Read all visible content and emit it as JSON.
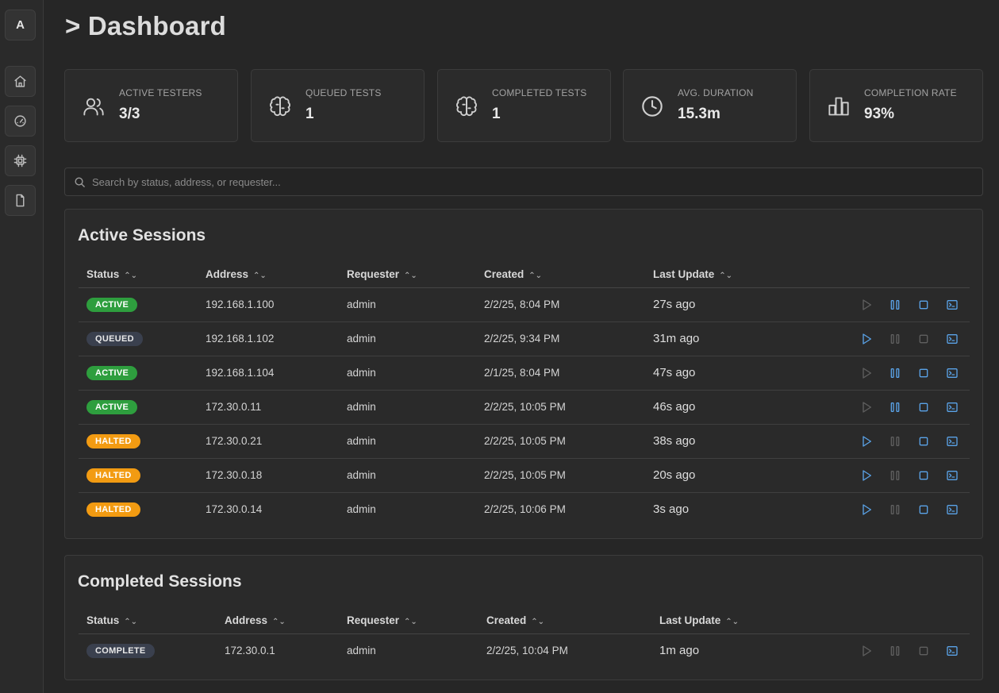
{
  "sidebar": {
    "avatar_letter": "A",
    "items": [
      {
        "name": "home-icon"
      },
      {
        "name": "gauge-icon"
      },
      {
        "name": "chip-icon"
      },
      {
        "name": "file-icon"
      }
    ]
  },
  "page": {
    "title": "> Dashboard"
  },
  "stats": [
    {
      "label": "ACTIVE TESTERS",
      "value": "3/3",
      "icon": "users-icon"
    },
    {
      "label": "QUEUED TESTS",
      "value": "1",
      "icon": "brain-icon"
    },
    {
      "label": "COMPLETED TESTS",
      "value": "1",
      "icon": "brain-icon"
    },
    {
      "label": "AVG. DURATION",
      "value": "15.3m",
      "icon": "clock-icon"
    },
    {
      "label": "COMPLETION RATE",
      "value": "93%",
      "icon": "bar-chart-icon"
    }
  ],
  "search": {
    "placeholder": "Search by status, address, or requester..."
  },
  "active_sessions": {
    "title": "Active Sessions",
    "columns": [
      "Status",
      "Address",
      "Requester",
      "Created",
      "Last Update"
    ],
    "rows": [
      {
        "status": "ACTIVE",
        "address": "192.168.1.100",
        "requester": "admin",
        "created": "2/2/25, 8:04 PM",
        "last_update": "27s ago"
      },
      {
        "status": "QUEUED",
        "address": "192.168.1.102",
        "requester": "admin",
        "created": "2/2/25, 9:34 PM",
        "last_update": "31m ago"
      },
      {
        "status": "ACTIVE",
        "address": "192.168.1.104",
        "requester": "admin",
        "created": "2/1/25, 8:04 PM",
        "last_update": "47s ago"
      },
      {
        "status": "ACTIVE",
        "address": "172.30.0.11",
        "requester": "admin",
        "created": "2/2/25, 10:05 PM",
        "last_update": "46s ago"
      },
      {
        "status": "HALTED",
        "address": "172.30.0.21",
        "requester": "admin",
        "created": "2/2/25, 10:05 PM",
        "last_update": "38s ago"
      },
      {
        "status": "HALTED",
        "address": "172.30.0.18",
        "requester": "admin",
        "created": "2/2/25, 10:05 PM",
        "last_update": "20s ago"
      },
      {
        "status": "HALTED",
        "address": "172.30.0.14",
        "requester": "admin",
        "created": "2/2/25, 10:06 PM",
        "last_update": "3s ago"
      }
    ]
  },
  "completed_sessions": {
    "title": "Completed Sessions",
    "columns": [
      "Status",
      "Address",
      "Requester",
      "Created",
      "Last Update"
    ],
    "rows": [
      {
        "status": "COMPLETE",
        "address": "172.30.0.1",
        "requester": "admin",
        "created": "2/2/25, 10:04 PM",
        "last_update": "1m ago"
      }
    ]
  },
  "colors": {
    "active": "#2e9e3e",
    "queued": "#3a404e",
    "halted": "#f29b12",
    "action_enabled": "#5aa3e8",
    "action_disabled": "#5f5f5f"
  }
}
